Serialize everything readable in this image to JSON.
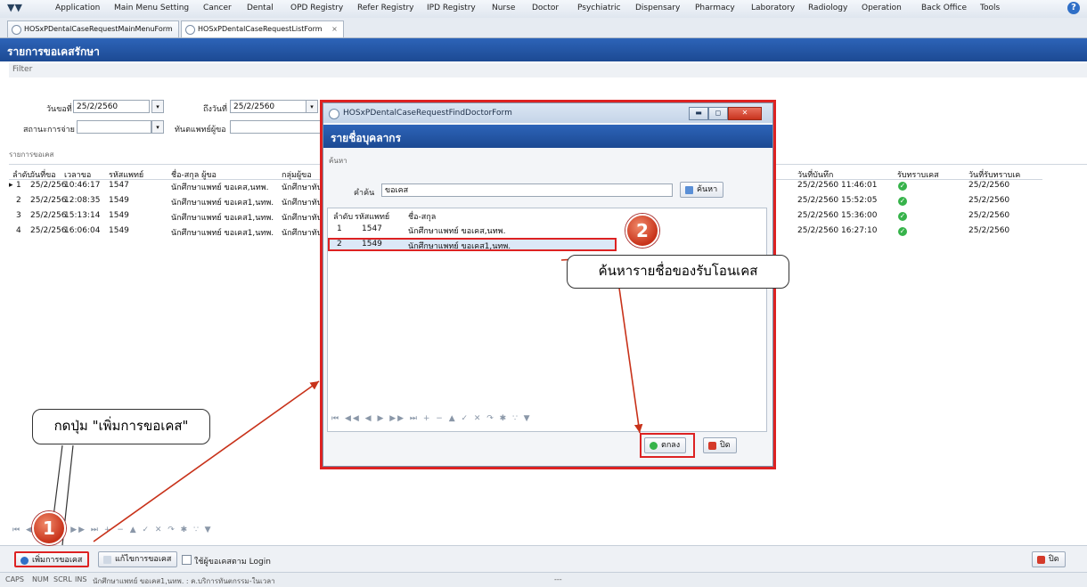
{
  "menubar": {
    "items": [
      "Application",
      "Main Menu Setting",
      "Cancer",
      "Dental",
      "OPD Registry",
      "Refer Registry",
      "IPD Registry",
      "Nurse",
      "Doctor",
      "Psychiatric",
      "Dispensary",
      "Pharmacy",
      "Laboratory",
      "Radiology",
      "Operation",
      "Back Office",
      "Tools"
    ]
  },
  "tabs": [
    {
      "label": "HOSxPDentalCaseRequestMainMenuForm"
    },
    {
      "label": "HOSxPDentalCaseRequestListForm",
      "close": "×"
    }
  ],
  "page": {
    "title": "รายการขอเคสรักษา",
    "filter_label": "Filter"
  },
  "filter": {
    "from_label": "วันขอที่",
    "from_value": "25/2/2560",
    "to_label": "ถึงวันที่",
    "to_value": "25/2/2560",
    "status_label": "สถานะการจ่าย",
    "dentist_label": "ทันตแพทย์ผู้ขอ"
  },
  "list": {
    "section_label": "รายการขอเคส",
    "columns_left": [
      "ลำดับ",
      "วันที่ขอ",
      "เวลาขอ",
      "รหัสแพทย์",
      "ชื่อ-สกุล ผู้ขอ",
      "กลุ่มผู้ขอ"
    ],
    "columns_right": [
      "วันที่บันทึก",
      "รับทราบเคส",
      "วันที่รับทราบเค"
    ],
    "rows": [
      {
        "no": "1",
        "date": "25/2/256",
        "time": "10:46:17",
        "code": "1547",
        "name": "นักศึกษาแพทย์ ขอเคส,นทพ.",
        "group": "นักศึกษาทัน",
        "saved": "25/2/2560 11:46:01",
        "ack_date": "25/2/2560"
      },
      {
        "no": "2",
        "date": "25/2/256",
        "time": "12:08:35",
        "code": "1549",
        "name": "นักศึกษาแพทย์ ขอเคส1,นทพ.",
        "group": "นักศึกษาทัน",
        "saved": "25/2/2560 15:52:05",
        "ack_date": "25/2/2560"
      },
      {
        "no": "3",
        "date": "25/2/256",
        "time": "15:13:14",
        "code": "1549",
        "name": "นักศึกษาแพทย์ ขอเคส1,นทพ.",
        "group": "นักศึกษาทัน",
        "saved": "25/2/2560 15:36:00",
        "ack_date": "25/2/2560"
      },
      {
        "no": "4",
        "date": "25/2/256",
        "time": "16:06:04",
        "code": "1549",
        "name": "นักศึกษาแพทย์ ขอเคส1,นทพ.",
        "group": "นักศึกษาทัน",
        "saved": "25/2/2560 16:27:10",
        "ack_date": "25/2/2560"
      }
    ],
    "pager": "⏮ ◀◀ ◀ ▶ ▶▶ ⏭ + − ▲ ✓ ✕ ↷ ✱ ∵ ▼"
  },
  "bottom": {
    "add_button": "เพิ่มการขอเคส",
    "edit_button": "แก้ไขการขอเคส",
    "login_checkbox": "ใช้ผู้ขอเคสตาม Login",
    "close_button": "ปิด"
  },
  "status": {
    "caps": "CAPS",
    "num": "NUM",
    "scrl": "SCRL",
    "ins": "INS",
    "user": "นักศึกษาแพทย์ ขอเคส1,นทพ. : ค.บริการทันตกรรม-ในเวลา",
    "dashes": "---"
  },
  "dialog": {
    "window_title": "HOSxPDentalCaseRequestFindDoctorForm",
    "header": "รายชื่อบุคลากร",
    "search_section": "ค้นหา",
    "keyword_label": "คำค้น",
    "keyword_value": "ขอเคส",
    "search_button": "ค้นหา",
    "columns": [
      "ลำดับ",
      "รหัสแพทย์",
      "ชื่อ-สกุล"
    ],
    "rows": [
      {
        "no": "1",
        "code": "1547",
        "name": "นักศึกษาแพทย์ ขอเคส,นทพ."
      },
      {
        "no": "2",
        "code": "1549",
        "name": "นักศึกษาแพทย์ ขอเคส1,นทพ."
      }
    ],
    "ok_button": "ตกลง",
    "close_button": "ปิด"
  },
  "annotations": {
    "callout_add": "กดปุ่ม \"เพิ่มการขอเคส\"",
    "callout_search": "ค้นหารายชื่อของรับโอนเคส",
    "badge1": "1",
    "badge2": "2"
  },
  "colors": {
    "header_blue": "#1c4a93",
    "annotation_red": "#dd2222",
    "ok_green": "#36b34a"
  }
}
